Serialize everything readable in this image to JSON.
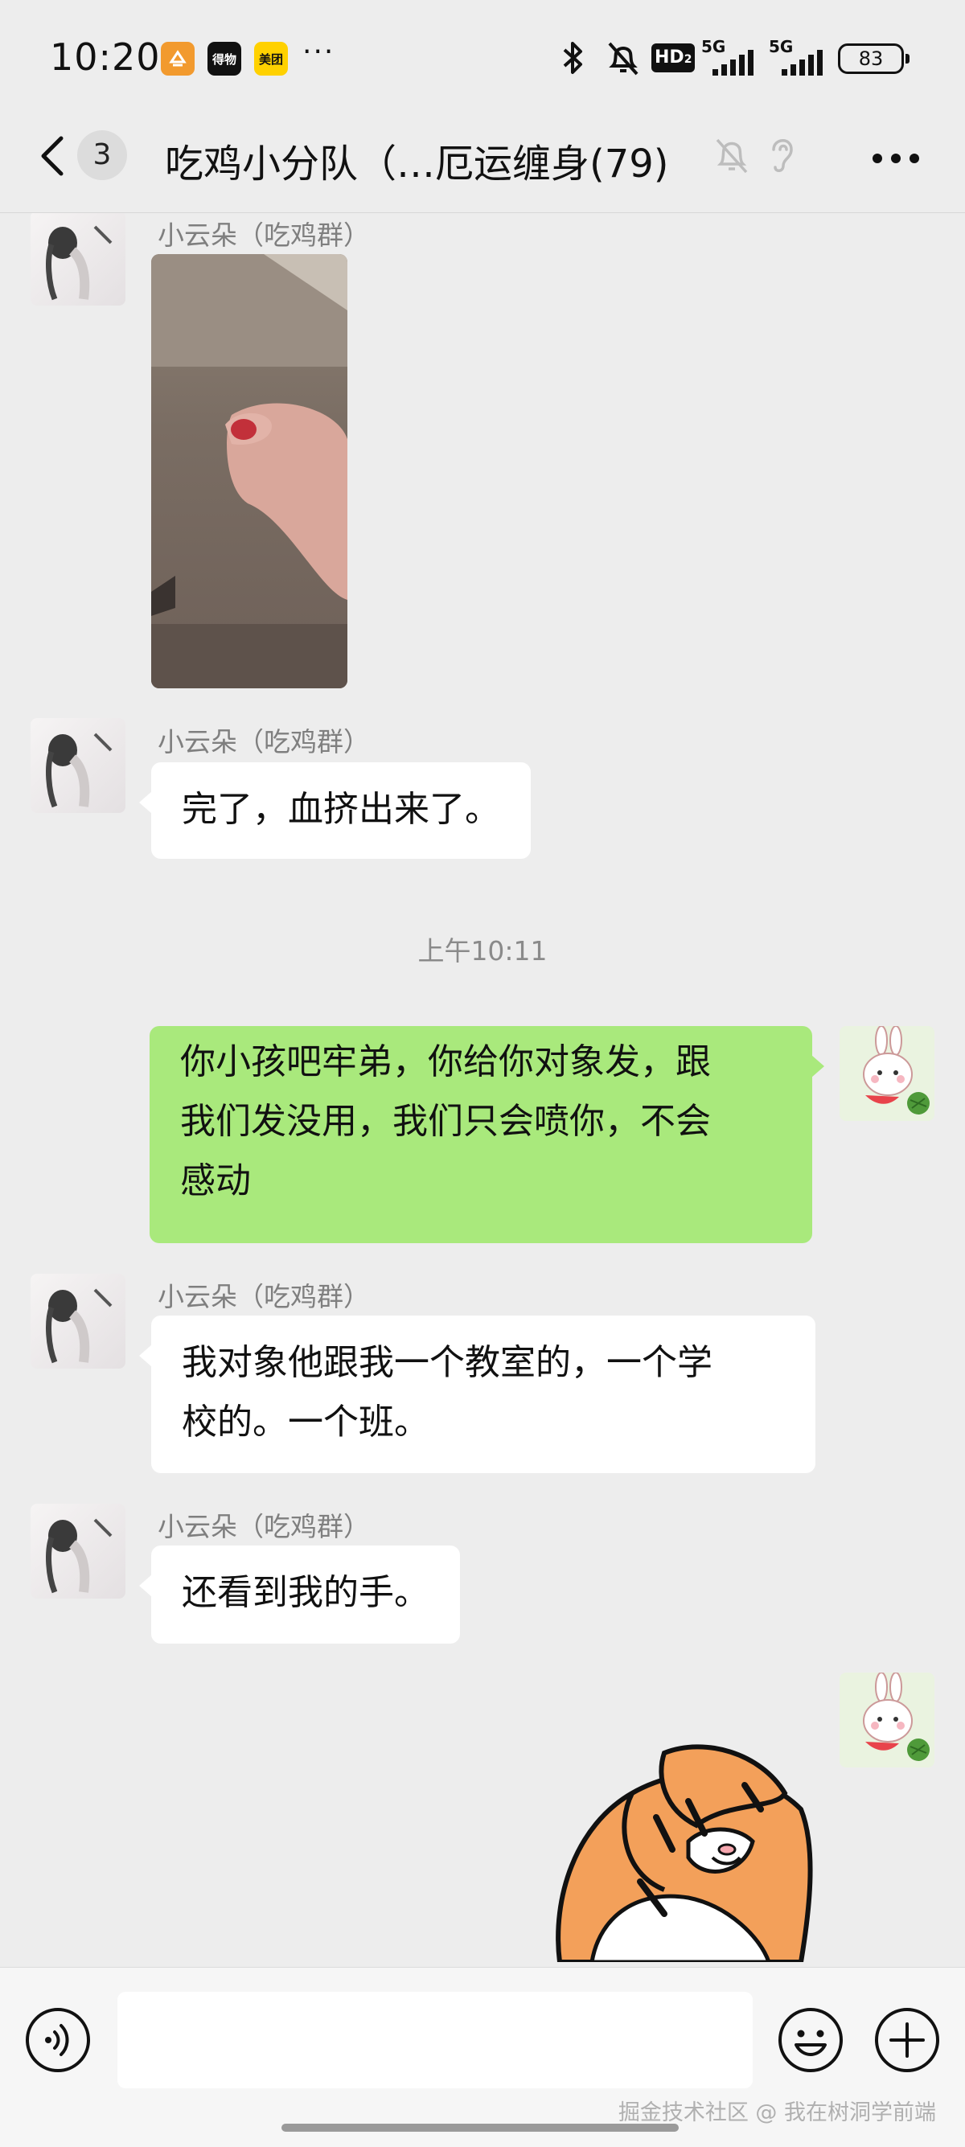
{
  "status_bar": {
    "time": "10:20",
    "apps": [
      {
        "name": "app-icon-orange",
        "color": "#f29a2e"
      },
      {
        "name": "app-icon-black",
        "text": "得物",
        "color": "#111111"
      },
      {
        "name": "app-icon-meituan",
        "text": "美团",
        "color": "#ffd100"
      }
    ],
    "more": "···",
    "network_label": "HD",
    "network_sub": "2",
    "signal_1_label": "5G",
    "signal_2_label": "5G",
    "battery": "83"
  },
  "header": {
    "unread_count": "3",
    "title": "吃鸡小分队（…厄运缠身(79)"
  },
  "messages": [
    {
      "type": "image",
      "sender": "小云朵（吃鸡群）"
    },
    {
      "type": "text",
      "sender": "小云朵（吃鸡群）",
      "text": "完了，血挤出来了。"
    },
    {
      "type": "timestamp",
      "text": "上午10:11"
    },
    {
      "type": "text",
      "outgoing": true,
      "lines": [
        "你小孩吧牢弟，你给你对象发，跟",
        "我们发没用，我们只会喷你，不会",
        "感动"
      ]
    },
    {
      "type": "text",
      "sender": "小云朵（吃鸡群）",
      "lines": [
        "我对象他跟我一个教室的，一个学",
        "校的。一个班。"
      ]
    },
    {
      "type": "text",
      "sender": "小云朵（吃鸡群）",
      "text": "还看到我的手。"
    },
    {
      "type": "sticker",
      "outgoing": true,
      "icon": "tiger-facepalm-sticker"
    }
  ],
  "input": {
    "placeholder": ""
  },
  "watermark": "掘金技术社区 @ 我在树洞学前端",
  "colors": {
    "background": "#ededed",
    "outgoing_bubble": "#a9e97c",
    "incoming_bubble": "#ffffff"
  }
}
